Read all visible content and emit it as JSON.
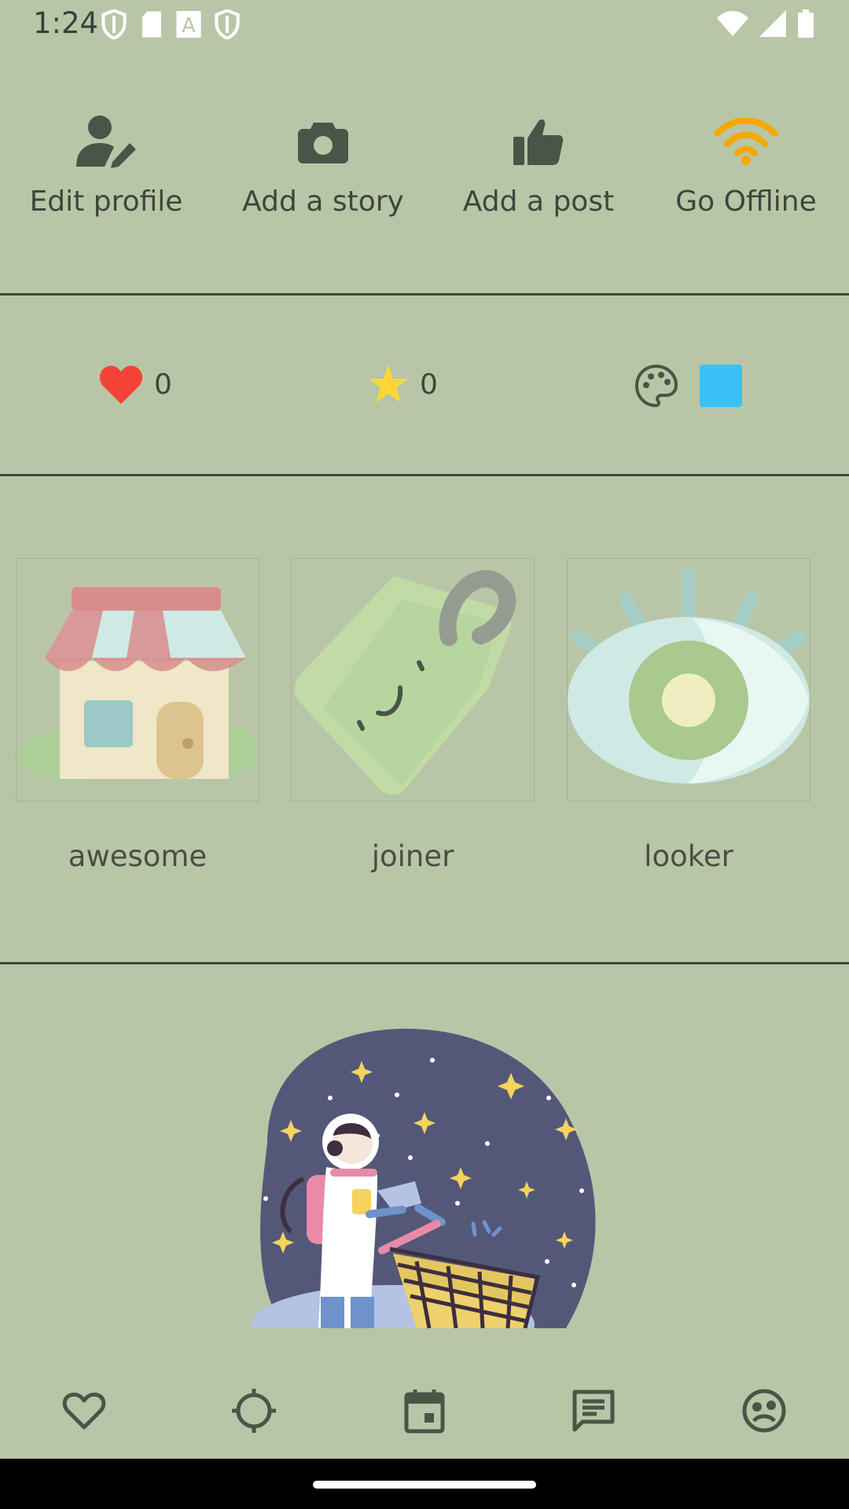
{
  "status_bar": {
    "time": "1:24",
    "icons_left": [
      "shield-icon",
      "sd-card-icon",
      "font-a-icon",
      "shield-icon"
    ],
    "icons_right": [
      "wifi-icon",
      "signal-icon",
      "battery-icon"
    ]
  },
  "actions": [
    {
      "label": "Edit profile",
      "icon": "user-edit-icon"
    },
    {
      "label": "Add a story",
      "icon": "camera-icon"
    },
    {
      "label": "Add a post",
      "icon": "thumbs-up-icon"
    },
    {
      "label": "Go Offline",
      "icon": "wifi-icon",
      "color": "#f5a800"
    }
  ],
  "stats": {
    "likes": "0",
    "stars": "0",
    "theme_color": "#39c1f7"
  },
  "badges": [
    {
      "caption": "awesome",
      "icon": "shop-icon"
    },
    {
      "caption": "joiner",
      "icon": "tag-icon"
    },
    {
      "caption": "looker",
      "icon": "eye-icon"
    }
  ],
  "bottom_nav": [
    "heart-icon",
    "target-icon",
    "calendar-icon",
    "chat-icon",
    "mask-icon"
  ],
  "colors": {
    "background": "#b8c6a7",
    "accent_orange": "#f5a800",
    "heart_red": "#f44336",
    "star_yellow": "#fdd835"
  }
}
